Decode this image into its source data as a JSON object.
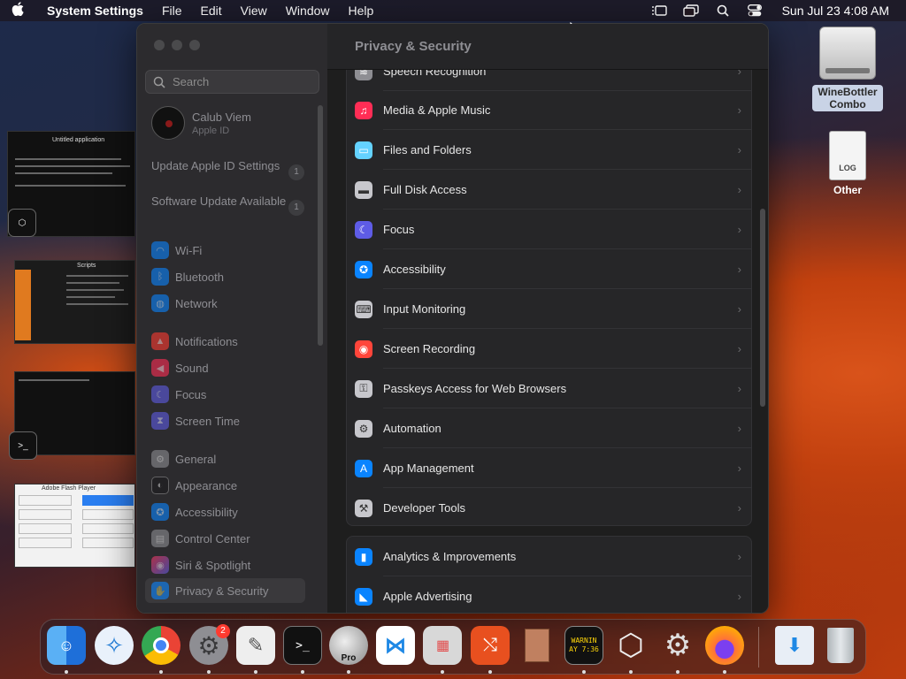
{
  "menubar": {
    "app_name": "System Settings",
    "menus": [
      "File",
      "Edit",
      "View",
      "Window",
      "Help"
    ],
    "clock": "Sun Jul 23  4:08 AM"
  },
  "sidebar": {
    "search_placeholder": "Search",
    "account": {
      "name": "Calub Viem",
      "subtitle": "Apple ID"
    },
    "notices": [
      {
        "label": "Update Apple ID Settings",
        "badge": "1"
      },
      {
        "label": "Software Update Available",
        "badge": "1"
      }
    ],
    "items": [
      {
        "label": "Wi-Fi",
        "icon": "wifi-icon",
        "color": "#0a84ff"
      },
      {
        "label": "Bluetooth",
        "icon": "bluetooth-icon",
        "color": "#0a84ff"
      },
      {
        "label": "Network",
        "icon": "globe-icon",
        "color": "#0a84ff"
      },
      {
        "label": "Notifications",
        "icon": "bell-icon",
        "color": "#ff3b30"
      },
      {
        "label": "Sound",
        "icon": "speaker-icon",
        "color": "#ff2d55"
      },
      {
        "label": "Focus",
        "icon": "moon-icon",
        "color": "#5e5ce6"
      },
      {
        "label": "Screen Time",
        "icon": "hourglass-icon",
        "color": "#5e5ce6"
      },
      {
        "label": "General",
        "icon": "gear-icon",
        "color": "#8e8e93"
      },
      {
        "label": "Appearance",
        "icon": "appearance-icon",
        "color": "#1c1c1e"
      },
      {
        "label": "Accessibility",
        "icon": "accessibility-icon",
        "color": "#0a84ff"
      },
      {
        "label": "Control Center",
        "icon": "control-center-icon",
        "color": "#8e8e93"
      },
      {
        "label": "Siri & Spotlight",
        "icon": "siri-icon",
        "color": "#bf5af2"
      },
      {
        "label": "Privacy & Security",
        "icon": "hand-icon",
        "color": "#0a84ff",
        "selected": true
      }
    ]
  },
  "content": {
    "title": "Privacy & Security",
    "group1": [
      {
        "label": "Speech Recognition",
        "icon": "waveform-icon",
        "color": "#8e8e93"
      },
      {
        "label": "Media & Apple Music",
        "icon": "music-note-icon",
        "color": "#ff2d55"
      },
      {
        "label": "Files and Folders",
        "icon": "folder-icon",
        "color": "#64d2ff"
      },
      {
        "label": "Full Disk Access",
        "icon": "disk-icon",
        "color": "#c7c7cc"
      },
      {
        "label": "Focus",
        "icon": "moon-icon",
        "color": "#5e5ce6"
      },
      {
        "label": "Accessibility",
        "icon": "accessibility-icon",
        "color": "#0a84ff"
      },
      {
        "label": "Input Monitoring",
        "icon": "keyboard-icon",
        "color": "#c7c7cc"
      },
      {
        "label": "Screen Recording",
        "icon": "record-icon",
        "color": "#ff453a"
      },
      {
        "label": "Passkeys Access for Web Browsers",
        "icon": "passkey-icon",
        "color": "#c7c7cc"
      },
      {
        "label": "Automation",
        "icon": "gears-icon",
        "color": "#c7c7cc"
      },
      {
        "label": "App Management",
        "icon": "app-store-icon",
        "color": "#0a84ff"
      },
      {
        "label": "Developer Tools",
        "icon": "hammer-icon",
        "color": "#c7c7cc"
      }
    ],
    "group2": [
      {
        "label": "Analytics & Improvements",
        "icon": "bar-chart-icon",
        "color": "#0a84ff"
      },
      {
        "label": "Apple Advertising",
        "icon": "megaphone-icon",
        "color": "#0a84ff"
      }
    ]
  },
  "desktop": {
    "icons": [
      {
        "label": "WineBottler Combo",
        "icon": "disk-image-icon"
      },
      {
        "label": "Other",
        "icon": "document-icon"
      }
    ]
  },
  "stage": {
    "thumb1_title": "Untitled application",
    "thumb2_title": "Scripts",
    "thumb4_title": "Adobe Flash Player"
  },
  "dock": {
    "apps": [
      {
        "name": "Finder",
        "icon": "finder-icon",
        "color": "#1e88e5"
      },
      {
        "name": "Safari",
        "icon": "safari-icon",
        "color": "#2196f3"
      },
      {
        "name": "Chrome",
        "icon": "chrome-icon",
        "color": "#ffffff"
      },
      {
        "name": "System Settings",
        "icon": "settings-icon",
        "color": "#8e8e93",
        "badge": "2"
      },
      {
        "name": "Script Editor",
        "icon": "script-editor-icon",
        "color": "#eeeeee"
      },
      {
        "name": "Terminal",
        "icon": "terminal-icon",
        "color": "#111111"
      },
      {
        "name": "Parallels",
        "icon": "sphere-icon",
        "color": "#b0b0b0",
        "caption": "Pro"
      },
      {
        "name": "VS Code",
        "icon": "vscode-icon",
        "color": "#1e88e5"
      },
      {
        "name": "Launchpad",
        "icon": "launchpad-icon",
        "color": "#d0d0d0"
      },
      {
        "name": "Remote Desktop",
        "icon": "remote-desktop-icon",
        "color": "#e8501f"
      },
      {
        "name": "Package",
        "icon": "box-icon",
        "color": "#c08060"
      },
      {
        "name": "Console",
        "icon": "console-icon",
        "color": "#111111",
        "caption": "WARNIN AY 7:36"
      },
      {
        "name": "Hyper",
        "icon": "hexagon-icon",
        "color": "#333333"
      },
      {
        "name": "Automator",
        "icon": "cog-icon",
        "color": "#e0e0e0"
      },
      {
        "name": "Firefox",
        "icon": "firefox-icon",
        "color": "#ff7139"
      },
      {
        "name": "Downloads",
        "icon": "downloads-icon",
        "color": "#dde6f0"
      },
      {
        "name": "Trash",
        "icon": "trash-icon",
        "color": "#cfd4d8"
      }
    ]
  }
}
